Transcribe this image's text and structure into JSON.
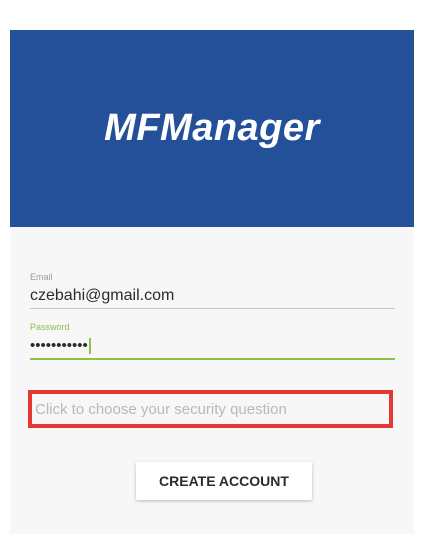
{
  "header": {
    "title": "MFManager",
    "background_color": "#24509a"
  },
  "form": {
    "email": {
      "label": "Email",
      "value": "czebahi@gmail.com"
    },
    "password": {
      "label": "Password",
      "value": "•••••••••••"
    },
    "security_question": {
      "placeholder": "Click to choose your security question",
      "highlight_color": "#e53935"
    },
    "accent_color": "#8bc34a",
    "create_button_label": "CREATE ACCOUNT"
  }
}
